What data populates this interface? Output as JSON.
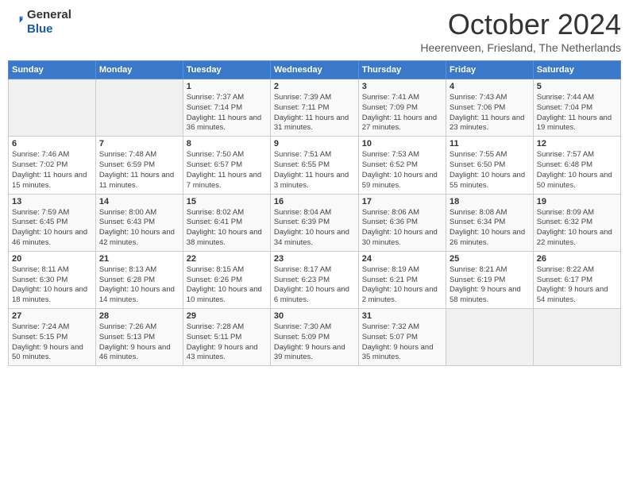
{
  "header": {
    "logo_general": "General",
    "logo_blue": "Blue",
    "title": "October 2024",
    "location": "Heerenveen, Friesland, The Netherlands"
  },
  "days_of_week": [
    "Sunday",
    "Monday",
    "Tuesday",
    "Wednesday",
    "Thursday",
    "Friday",
    "Saturday"
  ],
  "weeks": [
    [
      {
        "num": "",
        "sunrise": "",
        "sunset": "",
        "daylight": ""
      },
      {
        "num": "",
        "sunrise": "",
        "sunset": "",
        "daylight": ""
      },
      {
        "num": "1",
        "sunrise": "Sunrise: 7:37 AM",
        "sunset": "Sunset: 7:14 PM",
        "daylight": "Daylight: 11 hours and 36 minutes."
      },
      {
        "num": "2",
        "sunrise": "Sunrise: 7:39 AM",
        "sunset": "Sunset: 7:11 PM",
        "daylight": "Daylight: 11 hours and 31 minutes."
      },
      {
        "num": "3",
        "sunrise": "Sunrise: 7:41 AM",
        "sunset": "Sunset: 7:09 PM",
        "daylight": "Daylight: 11 hours and 27 minutes."
      },
      {
        "num": "4",
        "sunrise": "Sunrise: 7:43 AM",
        "sunset": "Sunset: 7:06 PM",
        "daylight": "Daylight: 11 hours and 23 minutes."
      },
      {
        "num": "5",
        "sunrise": "Sunrise: 7:44 AM",
        "sunset": "Sunset: 7:04 PM",
        "daylight": "Daylight: 11 hours and 19 minutes."
      }
    ],
    [
      {
        "num": "6",
        "sunrise": "Sunrise: 7:46 AM",
        "sunset": "Sunset: 7:02 PM",
        "daylight": "Daylight: 11 hours and 15 minutes."
      },
      {
        "num": "7",
        "sunrise": "Sunrise: 7:48 AM",
        "sunset": "Sunset: 6:59 PM",
        "daylight": "Daylight: 11 hours and 11 minutes."
      },
      {
        "num": "8",
        "sunrise": "Sunrise: 7:50 AM",
        "sunset": "Sunset: 6:57 PM",
        "daylight": "Daylight: 11 hours and 7 minutes."
      },
      {
        "num": "9",
        "sunrise": "Sunrise: 7:51 AM",
        "sunset": "Sunset: 6:55 PM",
        "daylight": "Daylight: 11 hours and 3 minutes."
      },
      {
        "num": "10",
        "sunrise": "Sunrise: 7:53 AM",
        "sunset": "Sunset: 6:52 PM",
        "daylight": "Daylight: 10 hours and 59 minutes."
      },
      {
        "num": "11",
        "sunrise": "Sunrise: 7:55 AM",
        "sunset": "Sunset: 6:50 PM",
        "daylight": "Daylight: 10 hours and 55 minutes."
      },
      {
        "num": "12",
        "sunrise": "Sunrise: 7:57 AM",
        "sunset": "Sunset: 6:48 PM",
        "daylight": "Daylight: 10 hours and 50 minutes."
      }
    ],
    [
      {
        "num": "13",
        "sunrise": "Sunrise: 7:59 AM",
        "sunset": "Sunset: 6:45 PM",
        "daylight": "Daylight: 10 hours and 46 minutes."
      },
      {
        "num": "14",
        "sunrise": "Sunrise: 8:00 AM",
        "sunset": "Sunset: 6:43 PM",
        "daylight": "Daylight: 10 hours and 42 minutes."
      },
      {
        "num": "15",
        "sunrise": "Sunrise: 8:02 AM",
        "sunset": "Sunset: 6:41 PM",
        "daylight": "Daylight: 10 hours and 38 minutes."
      },
      {
        "num": "16",
        "sunrise": "Sunrise: 8:04 AM",
        "sunset": "Sunset: 6:39 PM",
        "daylight": "Daylight: 10 hours and 34 minutes."
      },
      {
        "num": "17",
        "sunrise": "Sunrise: 8:06 AM",
        "sunset": "Sunset: 6:36 PM",
        "daylight": "Daylight: 10 hours and 30 minutes."
      },
      {
        "num": "18",
        "sunrise": "Sunrise: 8:08 AM",
        "sunset": "Sunset: 6:34 PM",
        "daylight": "Daylight: 10 hours and 26 minutes."
      },
      {
        "num": "19",
        "sunrise": "Sunrise: 8:09 AM",
        "sunset": "Sunset: 6:32 PM",
        "daylight": "Daylight: 10 hours and 22 minutes."
      }
    ],
    [
      {
        "num": "20",
        "sunrise": "Sunrise: 8:11 AM",
        "sunset": "Sunset: 6:30 PM",
        "daylight": "Daylight: 10 hours and 18 minutes."
      },
      {
        "num": "21",
        "sunrise": "Sunrise: 8:13 AM",
        "sunset": "Sunset: 6:28 PM",
        "daylight": "Daylight: 10 hours and 14 minutes."
      },
      {
        "num": "22",
        "sunrise": "Sunrise: 8:15 AM",
        "sunset": "Sunset: 6:26 PM",
        "daylight": "Daylight: 10 hours and 10 minutes."
      },
      {
        "num": "23",
        "sunrise": "Sunrise: 8:17 AM",
        "sunset": "Sunset: 6:23 PM",
        "daylight": "Daylight: 10 hours and 6 minutes."
      },
      {
        "num": "24",
        "sunrise": "Sunrise: 8:19 AM",
        "sunset": "Sunset: 6:21 PM",
        "daylight": "Daylight: 10 hours and 2 minutes."
      },
      {
        "num": "25",
        "sunrise": "Sunrise: 8:21 AM",
        "sunset": "Sunset: 6:19 PM",
        "daylight": "Daylight: 9 hours and 58 minutes."
      },
      {
        "num": "26",
        "sunrise": "Sunrise: 8:22 AM",
        "sunset": "Sunset: 6:17 PM",
        "daylight": "Daylight: 9 hours and 54 minutes."
      }
    ],
    [
      {
        "num": "27",
        "sunrise": "Sunrise: 7:24 AM",
        "sunset": "Sunset: 5:15 PM",
        "daylight": "Daylight: 9 hours and 50 minutes."
      },
      {
        "num": "28",
        "sunrise": "Sunrise: 7:26 AM",
        "sunset": "Sunset: 5:13 PM",
        "daylight": "Daylight: 9 hours and 46 minutes."
      },
      {
        "num": "29",
        "sunrise": "Sunrise: 7:28 AM",
        "sunset": "Sunset: 5:11 PM",
        "daylight": "Daylight: 9 hours and 43 minutes."
      },
      {
        "num": "30",
        "sunrise": "Sunrise: 7:30 AM",
        "sunset": "Sunset: 5:09 PM",
        "daylight": "Daylight: 9 hours and 39 minutes."
      },
      {
        "num": "31",
        "sunrise": "Sunrise: 7:32 AM",
        "sunset": "Sunset: 5:07 PM",
        "daylight": "Daylight: 9 hours and 35 minutes."
      },
      {
        "num": "",
        "sunrise": "",
        "sunset": "",
        "daylight": ""
      },
      {
        "num": "",
        "sunrise": "",
        "sunset": "",
        "daylight": ""
      }
    ]
  ]
}
